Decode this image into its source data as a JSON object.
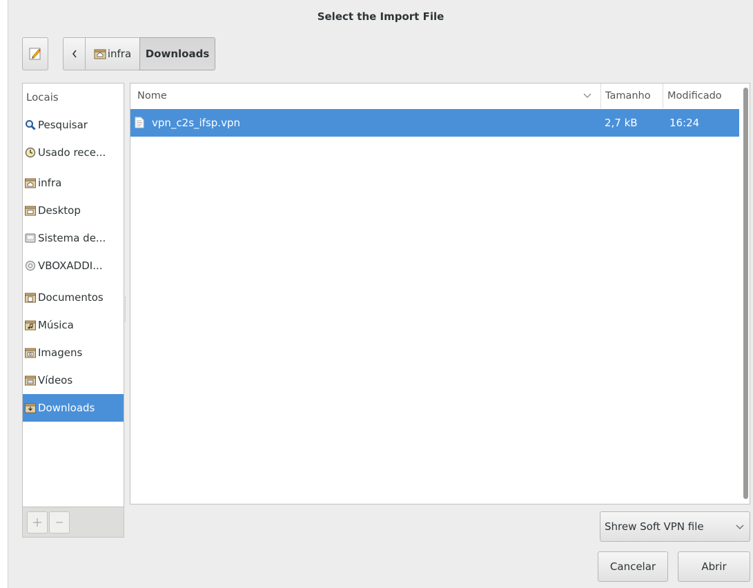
{
  "dialog": {
    "title": "Select the Import File"
  },
  "toolbar": {
    "edit_icon": "pencil-note-icon",
    "back_icon": "chevron-left-icon",
    "breadcrumb": [
      {
        "label": "infra",
        "icon": "home-folder-icon"
      },
      {
        "label": "Downloads"
      }
    ]
  },
  "sidebar": {
    "header": "Locais",
    "items": [
      {
        "label": "Pesquisar",
        "icon": "search-icon"
      },
      {
        "label": "Usado rece...",
        "icon": "recent-clock-icon"
      },
      {
        "label": "infra",
        "icon": "home-folder-icon"
      },
      {
        "label": "Desktop",
        "icon": "desktop-folder-icon"
      },
      {
        "label": "Sistema de...",
        "icon": "filesystem-drive-icon"
      },
      {
        "label": "VBOXADDI...",
        "icon": "optical-disc-icon"
      },
      {
        "label": "Documentos",
        "icon": "documents-folder-icon"
      },
      {
        "label": "Música",
        "icon": "music-folder-icon"
      },
      {
        "label": "Imagens",
        "icon": "pictures-folder-icon"
      },
      {
        "label": "Vídeos",
        "icon": "videos-folder-icon"
      },
      {
        "label": "Downloads",
        "icon": "downloads-folder-icon",
        "selected": true
      }
    ],
    "add_icon": "add-bookmark-icon",
    "remove_icon": "remove-bookmark-icon"
  },
  "file_list": {
    "columns": {
      "name": "Nome",
      "size": "Tamanho",
      "modified": "Modificado"
    },
    "rows": [
      {
        "name": "vpn_c2s_ifsp.vpn",
        "size": "2,7 kB",
        "modified": "16:24",
        "icon": "text-file-icon",
        "selected": true
      }
    ]
  },
  "filter": {
    "selected": "Shrew Soft VPN file"
  },
  "actions": {
    "cancel": "Cancelar",
    "open": "Abrir"
  },
  "colors": {
    "selection": "#4a90d9",
    "background": "#ededed"
  }
}
